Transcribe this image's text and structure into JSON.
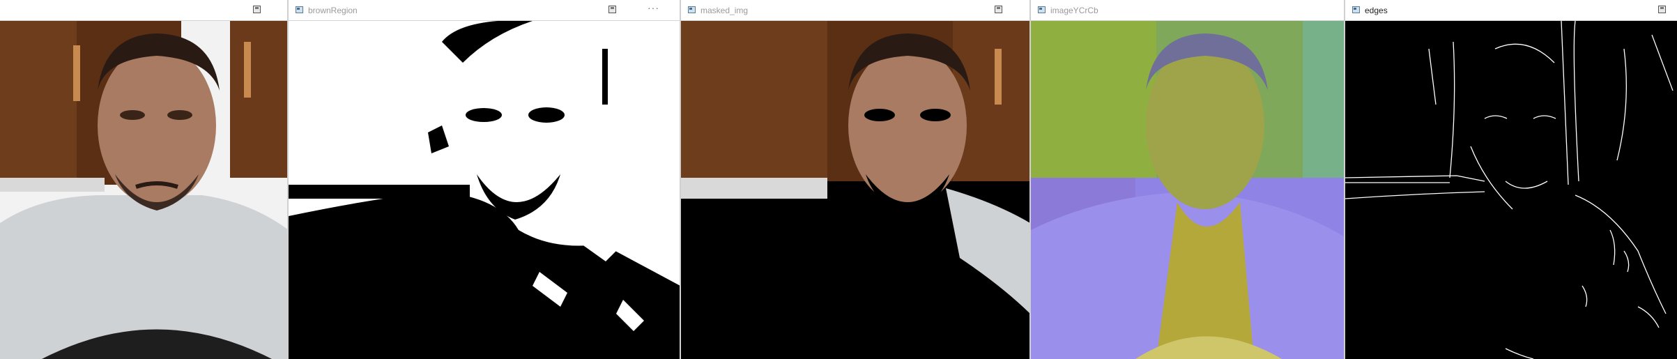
{
  "windows": [
    {
      "id": "frame",
      "title": ""
    },
    {
      "id": "brown-region",
      "title": "brownRegion"
    },
    {
      "id": "masked-img",
      "title": "masked_img"
    },
    {
      "id": "image-ycrcb",
      "title": "imageYCrCb"
    },
    {
      "id": "edges",
      "title": "edges"
    }
  ],
  "icons": {
    "window_icon": "window-icon",
    "save": "save-image-icon",
    "more": "more-options-icon"
  },
  "colors": {
    "titlebar": "#ffffff",
    "title_inactive": "#9a9a9a",
    "title_active": "#222222",
    "wood": "#6e3d1c",
    "ycrcb_green": "#7fa85a",
    "ycrcb_purple": "#8f84e6",
    "edges_bg": "#000000"
  }
}
